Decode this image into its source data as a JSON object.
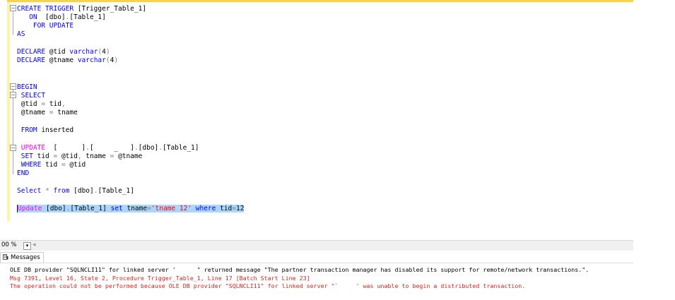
{
  "editor": {
    "lines": [
      {
        "id": "l1",
        "segments": [
          {
            "t": "CREATE TRIGGER",
            "c": "kw"
          },
          {
            "t": " [Trigger_Table_1]",
            "c": ""
          }
        ]
      },
      {
        "id": "l2",
        "segments": [
          {
            "t": "   ON",
            "c": "kw"
          },
          {
            "t": "  [dbo]",
            "c": ""
          },
          {
            "t": ".",
            "c": "gray"
          },
          {
            "t": "[Table_1]",
            "c": ""
          }
        ]
      },
      {
        "id": "l3",
        "segments": [
          {
            "t": "    FOR UPDATE",
            "c": "kw"
          }
        ]
      },
      {
        "id": "l4",
        "segments": [
          {
            "t": "AS",
            "c": "kw"
          }
        ]
      },
      {
        "id": "l5",
        "segments": [
          {
            "t": "DECLARE",
            "c": "kw"
          },
          {
            "t": " @tid ",
            "c": ""
          },
          {
            "t": "varchar",
            "c": "kw"
          },
          {
            "t": "(",
            "c": "gray"
          },
          {
            "t": "4",
            "c": ""
          },
          {
            "t": ")",
            "c": "gray"
          }
        ]
      },
      {
        "id": "l6",
        "segments": [
          {
            "t": "DECLARE",
            "c": "kw"
          },
          {
            "t": " @tname ",
            "c": ""
          },
          {
            "t": "varchar",
            "c": "kw"
          },
          {
            "t": "(",
            "c": "gray"
          },
          {
            "t": "4",
            "c": ""
          },
          {
            "t": ")",
            "c": "gray"
          }
        ]
      },
      {
        "id": "l7",
        "segments": [
          {
            "t": "BEGIN",
            "c": "kw"
          }
        ]
      },
      {
        "id": "l8",
        "segments": [
          {
            "t": " SELECT",
            "c": "kw"
          }
        ]
      },
      {
        "id": "l9",
        "segments": [
          {
            "t": " @tid ",
            "c": ""
          },
          {
            "t": "=",
            "c": "gray"
          },
          {
            "t": " tid",
            "c": ""
          },
          {
            "t": ",",
            "c": "gray"
          }
        ]
      },
      {
        "id": "l10",
        "segments": [
          {
            "t": " @tname ",
            "c": ""
          },
          {
            "t": "=",
            "c": "gray"
          },
          {
            "t": " tname",
            "c": ""
          }
        ]
      },
      {
        "id": "l11",
        "segments": [
          {
            "t": " FROM",
            "c": "kw"
          },
          {
            "t": " inserted",
            "c": ""
          }
        ]
      },
      {
        "id": "l12",
        "segments": [
          {
            "t": " UPDATE",
            "c": "pink"
          },
          {
            "t": "  [",
            "c": ""
          },
          {
            "t": "      ",
            "c": ""
          },
          {
            "t": "]",
            "c": ""
          },
          {
            "t": ".",
            "c": "gray"
          },
          {
            "t": "[     _   ]",
            "c": ""
          },
          {
            "t": ".",
            "c": "gray"
          },
          {
            "t": "[dbo]",
            "c": ""
          },
          {
            "t": ".",
            "c": "gray"
          },
          {
            "t": "[Table_1]",
            "c": ""
          }
        ]
      },
      {
        "id": "l13",
        "segments": [
          {
            "t": " SET",
            "c": "kw"
          },
          {
            "t": " tid ",
            "c": ""
          },
          {
            "t": "=",
            "c": "gray"
          },
          {
            "t": " @tid",
            "c": ""
          },
          {
            "t": ",",
            "c": "gray"
          },
          {
            "t": " tname ",
            "c": ""
          },
          {
            "t": "=",
            "c": "gray"
          },
          {
            "t": " @tname",
            "c": ""
          }
        ]
      },
      {
        "id": "l14",
        "segments": [
          {
            "t": " WHERE",
            "c": "kw"
          },
          {
            "t": " tid ",
            "c": ""
          },
          {
            "t": "=",
            "c": "gray"
          },
          {
            "t": " @tid",
            "c": ""
          }
        ]
      },
      {
        "id": "l15",
        "segments": [
          {
            "t": "END",
            "c": "kw"
          }
        ]
      },
      {
        "id": "l16",
        "segments": [
          {
            "t": "Select",
            "c": "kw"
          },
          {
            "t": " ",
            "c": ""
          },
          {
            "t": "*",
            "c": "gray"
          },
          {
            "t": " ",
            "c": ""
          },
          {
            "t": "from",
            "c": "kw"
          },
          {
            "t": " [dbo]",
            "c": ""
          },
          {
            "t": ".",
            "c": "gray"
          },
          {
            "t": "[Table_1]",
            "c": ""
          }
        ]
      },
      {
        "id": "l17",
        "selected": true,
        "segments": [
          {
            "t": "Update",
            "c": "pink"
          },
          {
            "t": " [dbo]",
            "c": ""
          },
          {
            "t": ".",
            "c": "gray"
          },
          {
            "t": "[Table_1] ",
            "c": ""
          },
          {
            "t": "set",
            "c": "kw"
          },
          {
            "t": " tname",
            "c": ""
          },
          {
            "t": "=",
            "c": "gray"
          },
          {
            "t": "'tname 12'",
            "c": "str"
          },
          {
            "t": " ",
            "c": ""
          },
          {
            "t": "where",
            "c": "kw"
          },
          {
            "t": " tid",
            "c": ""
          },
          {
            "t": "=",
            "c": "gray"
          },
          {
            "t": "12",
            "c": ""
          }
        ]
      }
    ]
  },
  "status": {
    "zoom": "00 %",
    "zoom_arrow": "▾",
    "scroll_left": "◂"
  },
  "tabs": {
    "messages_label": "Messages"
  },
  "messages": {
    "line1": "OLE DB provider \"SQLNCLI11\" for linked server '      \" returned message \"The partner transaction manager has disabled its support for remote/network transactions.\".",
    "line2": "Msg 7391, Level 16, State 2, Procedure Trigger_Table_1, Line 17 [Batch Start Line 23]",
    "line3": "The operation could not be performed because OLE DB provider \"SQLNCLI11\" for linked server \"`     ' was unable to begin a distributed transaction."
  },
  "colors": {
    "keyword": "#0000ff",
    "pink_keyword": "#ff00ff",
    "string": "#ff0000",
    "error": "#e0241b",
    "selection": "#add6ff"
  }
}
